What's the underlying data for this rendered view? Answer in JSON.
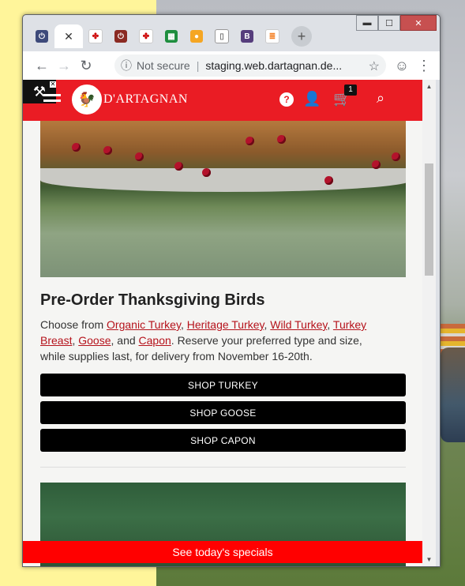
{
  "browser": {
    "tabs": [
      {
        "name": "power-tab",
        "icon": "power-icon"
      },
      {
        "name": "active-tab",
        "icon": "close-icon"
      },
      {
        "name": "dartagnan-tab",
        "icon": "dartagnan-logo-icon"
      },
      {
        "name": "power-tab-2",
        "icon": "power-icon"
      },
      {
        "name": "dartagnan-tab-2",
        "icon": "dartagnan-logo-icon"
      },
      {
        "name": "sheets-tab",
        "icon": "sheets-icon"
      },
      {
        "name": "chat-tab",
        "icon": "chat-icon"
      },
      {
        "name": "doc-tab",
        "icon": "document-icon"
      },
      {
        "name": "bootstrap-tab",
        "icon": "bootstrap-icon",
        "letter": "B"
      },
      {
        "name": "stack-tab",
        "icon": "stack-icon"
      }
    ],
    "new_tab_symbol": "+",
    "address": {
      "security": "Not secure",
      "url": "staging.web.dartagnan.de..."
    },
    "caption": {
      "minimize": "▬",
      "maximize": "☐",
      "close": "✕"
    }
  },
  "site": {
    "brand": "D'ARTAGNAN",
    "cart_count": "1",
    "help_symbol": "?",
    "article": {
      "title": "Pre-Order Thanksgiving Birds",
      "desc_prefix": "Choose from ",
      "links": [
        "Organic Turkey",
        "Heritage Turkey",
        "Wild Turkey",
        "Turkey Breast",
        "Goose",
        "Capon"
      ],
      "seps": [
        ", ",
        ", ",
        ", ",
        ", ",
        ", and "
      ],
      "desc_suffix": ". Reserve your preferred type and size, while supplies last, for delivery from November 16-20th."
    },
    "buttons": {
      "turkey": "SHOP TURKEY",
      "goose": "SHOP GOOSE",
      "capon": "SHOP CAPON"
    },
    "specials_bar": "See today's specials"
  },
  "colors": {
    "brand_red": "#ea1c24",
    "specials_red": "#ff0000",
    "link_red": "#b5121b"
  }
}
